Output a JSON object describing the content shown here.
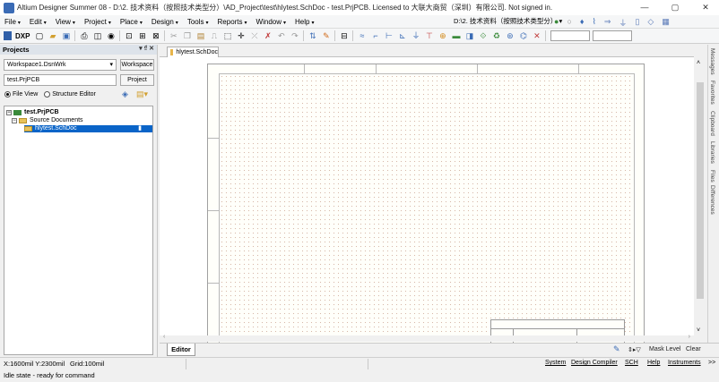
{
  "window": {
    "title": "Altium Designer Summer 08 - D:\\2. 技术资料（按照技术类型分）\\AD_Project\\test\\hlytest.SchDoc - test.PrjPCB. Licensed to 大联大商贸（深圳）有限公司. Not signed in.",
    "minimize": "—",
    "maximize": "▢",
    "close": "✕"
  },
  "menu": {
    "items": [
      "File",
      "Edit",
      "View",
      "Project",
      "Place",
      "Design",
      "Tools",
      "Reports",
      "Window",
      "Help"
    ],
    "path_selector": "D:\\2. 技术资料（按照技术类型分）"
  },
  "toolbar": {
    "dxp_label": "DXP",
    "icons": [
      "new-icon",
      "open-icon",
      "save-icon",
      "print-icon",
      "preview-icon",
      "component-icon",
      "fit-icon",
      "zoom-area-icon",
      "zoom-select-icon",
      "cut-icon",
      "copy-icon",
      "paste-icon",
      "rubber-stamp-icon",
      "select-area-icon",
      "move-icon",
      "deselect-icon",
      "clear-filter-icon",
      "undo-icon",
      "redo-icon",
      "cross-probe-icon",
      "highlight-icon",
      "browse-icon",
      "wire-icon",
      "bus-icon",
      "bus-entry-icon",
      "net-label-icon",
      "gnd-icon",
      "vcc-icon",
      "part-icon",
      "sheet-symbol-icon",
      "sheet-entry-icon",
      "port-icon",
      "no-erc-icon",
      "close-x-icon"
    ]
  },
  "projects_panel": {
    "header": "Projects",
    "header_controls": "▾ ₫ ✕",
    "workspace_value": "Workspace1.DsnWrk",
    "workspace_button": "Workspace",
    "project_value": "test.PrjPCB",
    "project_button": "Project",
    "view_file": "File View",
    "view_structure": "Structure Editor",
    "tree": {
      "project": "test.PrjPCB",
      "folder": "Source Documents",
      "document": "hlytest.SchDoc"
    }
  },
  "document_tab": {
    "label": "hlytest.SchDoc"
  },
  "editor_tab": {
    "label": "Editor"
  },
  "bottom_controls": {
    "mask_level": "Mask Level",
    "clear": "Clear"
  },
  "right_dock": {
    "tabs": [
      "Messages",
      "Favorites",
      "Clipboard",
      "Libraries",
      "Files",
      "Differences"
    ]
  },
  "status": {
    "coords": "X:1600mil Y:2300mil",
    "grid": "Grid:100mil",
    "state": "Idle state - ready for command",
    "panels": [
      "System",
      "Design Compiler",
      "SCH",
      "Help",
      "Instruments",
      ">>"
    ]
  },
  "colors": {
    "selection": "#0a64c8",
    "sheet_grid_dot": "#d7b8a8",
    "panel_header": "#dde3ea"
  }
}
